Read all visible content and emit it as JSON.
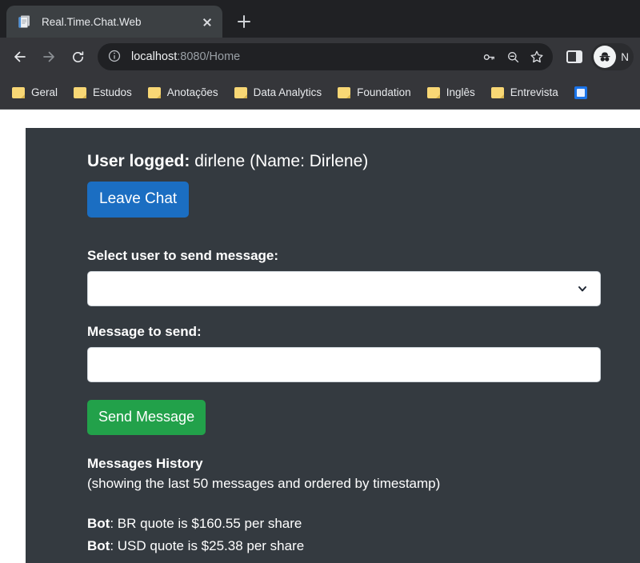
{
  "browser": {
    "tab": {
      "title": "Real.Time.Chat.Web",
      "favicon_icon": "document-page-icon",
      "close_icon": "close-icon"
    },
    "new_tab_icon": "plus-icon",
    "nav": {
      "back_icon": "arrow-left-icon",
      "forward_icon": "arrow-right-icon",
      "reload_icon": "reload-icon"
    },
    "omnibox": {
      "info_icon": "info-circle-icon",
      "host": "localhost",
      "path": ":8080/Home",
      "full_url": "localhost:8080/Home",
      "key_icon": "key-icon",
      "zoom_out_icon": "zoom-out-icon",
      "bookmark_icon": "star-icon"
    },
    "side_panel_icon": "side-panel-icon",
    "profile": {
      "incognito_icon": "incognito-icon",
      "name": "N"
    },
    "bookmarks": [
      {
        "label": "Geral",
        "icon": "folder-icon"
      },
      {
        "label": "Estudos",
        "icon": "folder-icon"
      },
      {
        "label": "Anotações",
        "icon": "folder-icon"
      },
      {
        "label": "Data Analytics",
        "icon": "folder-icon"
      },
      {
        "label": "Foundation",
        "icon": "folder-icon"
      },
      {
        "label": "Inglês",
        "icon": "folder-icon"
      },
      {
        "label": "Entrevista",
        "icon": "folder-icon"
      }
    ],
    "bookmark_overflow_icon": "bookmark-site-icon"
  },
  "page": {
    "user_logged": {
      "label": "User logged:",
      "value": " dirlene (Name: Dirlene)"
    },
    "leave_chat_label": "Leave Chat",
    "select_user": {
      "label": "Select user to send message:",
      "value": "",
      "chevron_icon": "chevron-down-icon"
    },
    "message": {
      "label": "Message to send:",
      "value": "",
      "placeholder": ""
    },
    "send_label": "Send Message",
    "history": {
      "title": "Messages History",
      "subtitle": "(showing the last 50 messages and ordered by timestamp)",
      "messages": [
        {
          "sender": "Bot",
          "separator": ": ",
          "text": "BR quote is $160.55 per share"
        },
        {
          "sender": "Bot",
          "separator": ": ",
          "text": "USD quote is $25.38 per share"
        }
      ]
    }
  },
  "colors": {
    "page_bg": "#343a40",
    "primary": "#1b6ec2",
    "success": "#22a14a",
    "chrome_bg": "#202124",
    "toolbar_bg": "#35363a"
  }
}
